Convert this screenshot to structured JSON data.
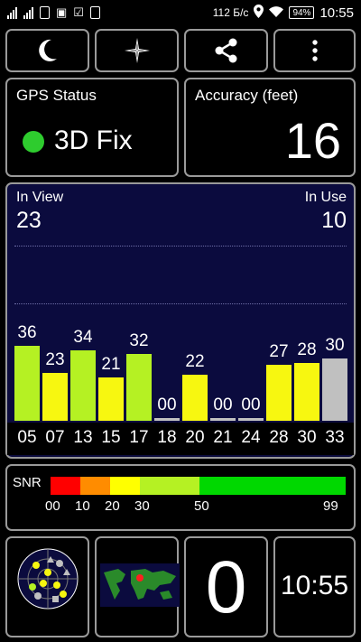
{
  "status_bar": {
    "speed": "112 Б/с",
    "battery": "94%",
    "time": "10:55"
  },
  "toolbar": {
    "buttons": [
      {
        "icon": "moon-icon"
      },
      {
        "icon": "compass-icon"
      },
      {
        "icon": "share-icon"
      },
      {
        "icon": "more-vertical-icon"
      }
    ]
  },
  "gps_status": {
    "title": "GPS Status",
    "fix": "3D Fix",
    "fix_color": "#2ecc2e"
  },
  "accuracy": {
    "title": "Accuracy (feet)",
    "value": "16"
  },
  "satellites": {
    "in_view_label": "In View",
    "in_view": "23",
    "in_use_label": "In Use",
    "in_use": "10",
    "colors": {
      "green": "#b5f123",
      "yellow": "#f7f710",
      "gray": "#c0c0c0"
    }
  },
  "chart_data": {
    "type": "bar",
    "categories": [
      "05",
      "07",
      "13",
      "15",
      "17",
      "18",
      "20",
      "21",
      "24",
      "28",
      "30",
      "33"
    ],
    "values": [
      36,
      23,
      34,
      21,
      32,
      0,
      22,
      0,
      0,
      27,
      28,
      30
    ],
    "labels": [
      "36",
      "23",
      "34",
      "21",
      "32",
      "00",
      "22",
      "00",
      "00",
      "27",
      "28",
      "30"
    ],
    "bar_colors": [
      "green",
      "yellow",
      "green",
      "yellow",
      "green",
      "gray",
      "yellow",
      "gray",
      "gray",
      "yellow",
      "yellow",
      "gray"
    ],
    "ylim": [
      0,
      60
    ]
  },
  "snr": {
    "label": "SNR",
    "ticks": [
      "00",
      "10",
      "20",
      "30",
      "50",
      "99"
    ],
    "segments": [
      {
        "color": "#ff0000"
      },
      {
        "color": "#ff8c00"
      },
      {
        "color": "#ffff00"
      },
      {
        "color": "#b5f123"
      },
      {
        "color": "#00d800"
      }
    ]
  },
  "bottom": {
    "count": "0",
    "clock": "10:55"
  }
}
